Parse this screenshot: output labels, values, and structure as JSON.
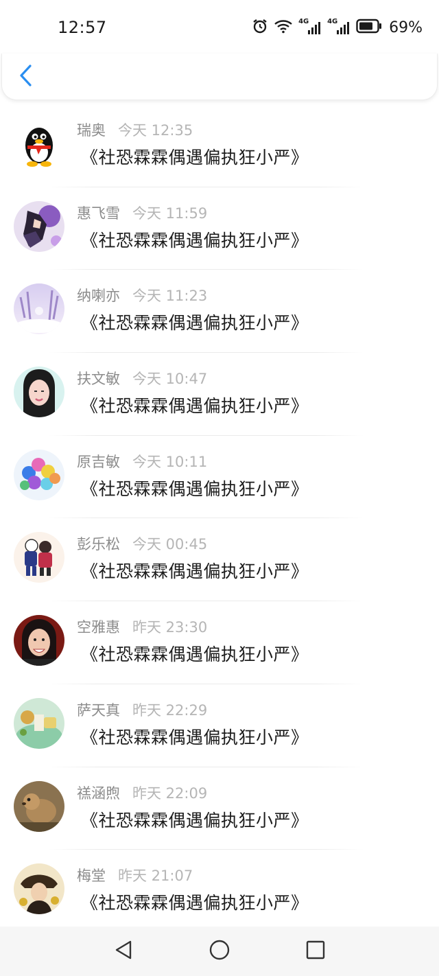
{
  "status_bar": {
    "time": "12:57",
    "battery": "69%",
    "network_label_1": "4G",
    "network_label_2": "4G",
    "icons": [
      "alarm-icon",
      "wifi-icon",
      "signal-icon",
      "signal-icon",
      "battery-icon"
    ]
  },
  "header": {
    "back_icon": "chevron-left-icon",
    "accent": "#2a8ef0"
  },
  "messages": [
    {
      "name": "瑞奥",
      "time": "今天 12:35",
      "text": "《社恐霖霖偶遇偏执狂小严》",
      "avatar": "qq-penguin"
    },
    {
      "name": "惠飞雪",
      "time": "今天 11:59",
      "text": "《社恐霖霖偶遇偏执狂小严》",
      "avatar": "anime-purple"
    },
    {
      "name": "纳喇亦",
      "time": "今天 11:23",
      "text": "《社恐霖霖偶遇偏执狂小严》",
      "avatar": "snow-forest"
    },
    {
      "name": "扶文敏",
      "time": "今天 10:47",
      "text": "《社恐霖霖偶遇偏执狂小严》",
      "avatar": "portrait-girl"
    },
    {
      "name": "原吉敏",
      "time": "今天 10:11",
      "text": "《社恐霖霖偶遇偏执狂小严》",
      "avatar": "balloons"
    },
    {
      "name": "彭乐松",
      "time": "今天 00:45",
      "text": "《社恐霖霖偶遇偏执狂小严》",
      "avatar": "cartoon-couple"
    },
    {
      "name": "空雅惠",
      "time": "昨天 23:30",
      "text": "《社恐霖霖偶遇偏执狂小严》",
      "avatar": "portrait-smile"
    },
    {
      "name": "萨天真",
      "time": "昨天 22:29",
      "text": "《社恐霖霖偶遇偏执狂小严》",
      "avatar": "food-table"
    },
    {
      "name": "禚涵煦",
      "time": "昨天 22:09",
      "text": "《社恐霖霖偶遇偏执狂小严》",
      "avatar": "prairie-dog"
    },
    {
      "name": "梅堂",
      "time": "昨天 21:07",
      "text": "《社恐霖霖偶遇偏执狂小严》",
      "avatar": "vintage-lady"
    }
  ],
  "bottom_nav": {
    "icons": [
      "back-triangle-icon",
      "home-circle-icon",
      "recents-square-icon"
    ]
  }
}
